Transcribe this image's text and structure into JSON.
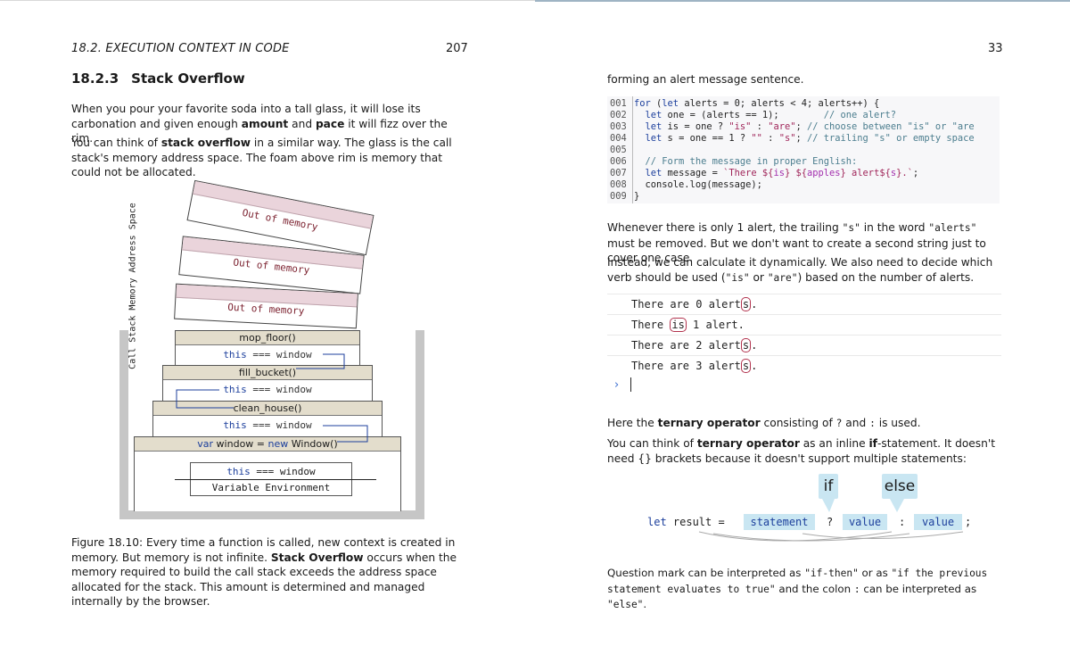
{
  "left_page": {
    "running_header": "18.2.  EXECUTION CONTEXT IN CODE",
    "page_number": "207",
    "section_number": "18.2.3",
    "section_title": "Stack Overflow",
    "para1": {
      "a": "When you pour your favorite soda into a tall glass, it will lose its carbonation and given enough ",
      "b1": "amount",
      "c": " and ",
      "b2": "pace",
      "d": " it will fizz over the rim."
    },
    "para2": {
      "a": "You can think of ",
      "b": "stack overflow",
      "c": " in a similar way.  The glass is the call stack's memory address space.  The foam above rim is memory that could not be allocated."
    },
    "figure": {
      "overflow_label": "Out of memory",
      "vertical_label": "Call Stack Memory Address Space",
      "frames": [
        {
          "name": "mop_floor()",
          "this_kw": "this",
          "this_rest": " === window"
        },
        {
          "name": "fill_bucket()",
          "this_kw": "this",
          "this_rest": " === window"
        },
        {
          "name": "clean_house()",
          "this_kw": "this",
          "this_rest": " === window"
        }
      ],
      "global_kw1": "var",
      "global_mid": " window = ",
      "global_kw2": "new",
      "global_end": " Window()",
      "global_this_kw": "this",
      "global_this_rest": " === window",
      "variable_environment": "Variable Environment"
    },
    "caption": {
      "a": "Figure 18.10: Every time a function is called, new context is created in memory. But memory is not infinite.  ",
      "b": "Stack Overflow",
      "c": " occurs when the memory required to build the call stack exceeds the address space allocated for the stack.  This amount is determined and managed internally by the browser."
    }
  },
  "right_page": {
    "page_number": "33",
    "intro": "forming an alert message sentence.",
    "code_line_numbers": [
      "001",
      "002",
      "003",
      "004",
      "005",
      "006",
      "007",
      "008",
      "009"
    ],
    "code": {
      "l1": {
        "k": "for",
        "a": " (",
        "k2": "let",
        "b": " alerts = 0; alerts < 4; alerts++) {"
      },
      "l2": {
        "a": "  ",
        "k": "let",
        "b": " one = (alerts == 1);        ",
        "c": "// one alert?"
      },
      "l3": {
        "a": "  ",
        "k": "let",
        "b": " is = one ? ",
        "s1": "\"is\"",
        "m": " : ",
        "s2": "\"are\"",
        "e": "; ",
        "c": "// choose between \"is\" or \"are"
      },
      "l4": {
        "a": "  ",
        "k": "let",
        "b": " s = one == 1 ? ",
        "s1": "\"\"",
        "m": " : ",
        "s2": "\"s\"",
        "e": "; ",
        "c": "// trailing \"s\" or empty space"
      },
      "l6": {
        "a": "  ",
        "c": "// Form the message in proper English:"
      },
      "l7": {
        "a": "  ",
        "k": "let",
        "b": " message = ",
        "s1": "`There ${",
        "t1": "is",
        "s2": "} ${",
        "t2": "apples",
        "s3": "} alert${",
        "t3": "s",
        "s4": "}.`",
        "e": ";"
      },
      "l8": {
        "a": "  console.log(message);"
      },
      "l9": {
        "a": "}"
      }
    },
    "para_a": {
      "a": "Whenever there is only 1 alert, the trailing ",
      "m1": "\"s\"",
      "b": " in the word ",
      "m2": "\"alerts\"",
      "c": " must be removed.  But we don't want to create a second string just to cover one case."
    },
    "para_b": {
      "a": "Instead, we can calculate it dynamically.  We also need to decide which verb should be used (",
      "m1": "\"is\"",
      "b": " or ",
      "m2": "\"are\"",
      "c": ") based on the number of alerts."
    },
    "console": {
      "rows": [
        {
          "pre": "There are 0 alert",
          "hl": "s",
          "post": "."
        },
        {
          "pre": "There ",
          "hl": "is",
          "post": " 1 alert."
        },
        {
          "pre": "There are 2 alert",
          "hl": "s",
          "post": "."
        },
        {
          "pre": "There are 3 alert",
          "hl": "s",
          "post": "."
        }
      ],
      "prompt": "›"
    },
    "para_c": {
      "a": "Here the ",
      "b": "ternary operator",
      "c": " consisting of ",
      "m1": "?",
      "d": " and ",
      "m2": ":",
      "e": " is used."
    },
    "para_d": {
      "a": "You can think of ",
      "b": "ternary operator",
      "c": " as an inline ",
      "b2": "if",
      "d": "-statement.  It doesn't need {} brackets because it doesn't support multiple statements:"
    },
    "ternary": {
      "bubble_if": "if",
      "bubble_else": "else",
      "let_kw": "let",
      "result": " result =",
      "statement": "statement",
      "q": "?",
      "value1": "value",
      "colon": ":",
      "value2": "value",
      "semi": ";"
    },
    "para_e": {
      "a": "Question mark can be interpreted as ",
      "m1": "\"if-then\"",
      "b": " or as ",
      "m2": "\"if the previous statement evaluates to true\"",
      "c": " and the colon ",
      "m3": ":",
      "d": " can be interpreted as ",
      "m4": "\"else\"",
      "e": "."
    }
  }
}
